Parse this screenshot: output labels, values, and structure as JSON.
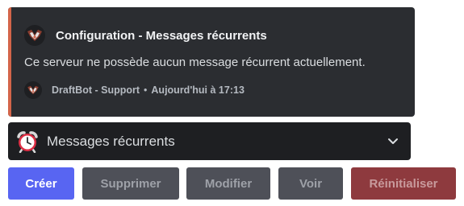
{
  "embed": {
    "accent_color": "#d4654a",
    "author_icon": "draftbot-logo-icon",
    "title": "Configuration - Messages récurrents",
    "description": "Ce serveur ne possède aucun message récurrent actuellement.",
    "footer": {
      "icon": "draftbot-logo-icon",
      "text": "DraftBot - Support",
      "separator": "•",
      "timestamp": "Aujourd'hui à 17:13"
    }
  },
  "select_menu": {
    "emoji": "alarm-clock-icon",
    "selected_label": "Messages récurrents",
    "chevron": "chevron-down-icon"
  },
  "buttons": [
    {
      "label": "Créer",
      "style": "primary",
      "color": "#5865f2"
    },
    {
      "label": "Supprimer",
      "style": "secondary",
      "color": "#4e5058"
    },
    {
      "label": "Modifier",
      "style": "secondary",
      "color": "#4e5058"
    },
    {
      "label": "Voir",
      "style": "secondary",
      "color": "#4e5058"
    },
    {
      "label": "Réinitialiser",
      "style": "danger",
      "color": "#8e3a3e"
    }
  ]
}
